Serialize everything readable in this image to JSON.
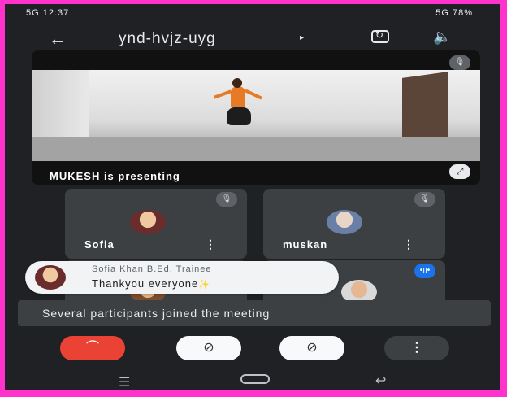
{
  "status_bar": {
    "left_text": "5G 12:37",
    "right_text": "5G 78%"
  },
  "header": {
    "back_icon": "arrow-left",
    "meeting_code": "ynd-hvjz-uyg",
    "caret": "▸"
  },
  "presentation": {
    "label": "MUKESH is presenting"
  },
  "participants": [
    {
      "name": "Sofia"
    },
    {
      "name": "muskan"
    },
    {
      "name": ""
    },
    {
      "name": ""
    }
  ],
  "toast": {
    "sender": "Sofia Khan B.Ed. Trainee",
    "message": "Thankyou everyone",
    "emoji": "✨"
  },
  "banner": {
    "text": "Several participants joined the meeting"
  },
  "controls": {
    "end_call": "⌒",
    "camera_off": "⊘",
    "mic_off": "⊘",
    "more": "⋮"
  }
}
